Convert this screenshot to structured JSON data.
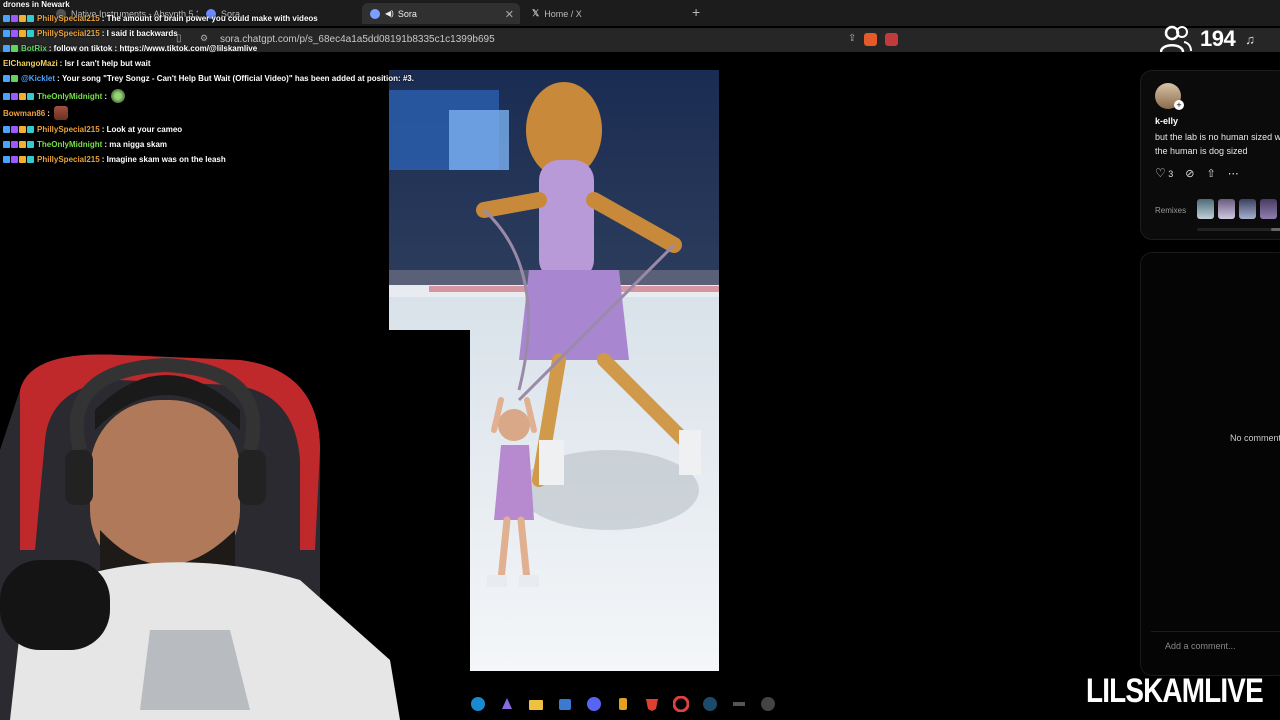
{
  "browser": {
    "tabs": [
      {
        "label": "Native Instruments - Absynth 5.3.4 ..."
      },
      {
        "label": "Sora"
      },
      {
        "label": "Sora",
        "active": true
      },
      {
        "label": "Home / X"
      }
    ],
    "url": "sora.chatgpt.com/p/s_68ec4a1a5dd08191b8335c1c1399b695"
  },
  "chat": {
    "header": "drones in Newark",
    "messages": [
      {
        "user": "PhillySpecial215",
        "user_color": "#e8a23a",
        "text": "The amount of brain power you could make with videos"
      },
      {
        "user": "PhillySpecial215",
        "user_color": "#e8a23a",
        "text": "I said it backwards"
      },
      {
        "user": "BotRix",
        "user_color": "#5fd45f",
        "text": "follow on tiktok : https://www.tiktok.com/@lilskamlive"
      },
      {
        "user": "ElChangoMazi",
        "user_color": "#f0d060",
        "text": "lsr I can't help but wait"
      },
      {
        "user": "@Kicklet",
        "user_color": "#4aa3ff",
        "text": "Your song \"Trey Songz - Can't Help But Wait (Official Video)\" has been added at position: #3."
      },
      {
        "user": "TheOnlyMidnight",
        "user_color": "#7adf4a",
        "text": ""
      },
      {
        "user": "Bowman86",
        "user_color": "#f0a040",
        "text": ""
      },
      {
        "user": "PhillySpecial215",
        "user_color": "#e8a23a",
        "text": "Look at your cameo"
      },
      {
        "user": "TheOnlyMidnight",
        "user_color": "#7adf4a",
        "text": "ma nigga skam"
      },
      {
        "user": "PhillySpecial215",
        "user_color": "#e8a23a",
        "text": "Imagine skam was on the leash"
      }
    ]
  },
  "viewers": {
    "count": "194"
  },
  "post": {
    "username": "k-elly",
    "caption": "but the lab is no human sized w the human is dog sized",
    "likes": "3",
    "remixes_label": "Remixes"
  },
  "comments": {
    "empty_text": "No comments",
    "placeholder": "Add a comment..."
  },
  "overlay": {
    "brand": "LILSKAMLIVE"
  },
  "taskbar": {
    "icons": [
      "edge-icon",
      "copilot-icon",
      "folder-icon",
      "store-icon",
      "discord-icon",
      "obs-icon",
      "brave-icon",
      "chrome-icon",
      "steam-icon",
      "app-icon",
      "4k-icon"
    ]
  },
  "colors": {
    "accent_blue": "#4aa3ff",
    "chat_green": "#5fd45f",
    "bg": "#000000"
  }
}
